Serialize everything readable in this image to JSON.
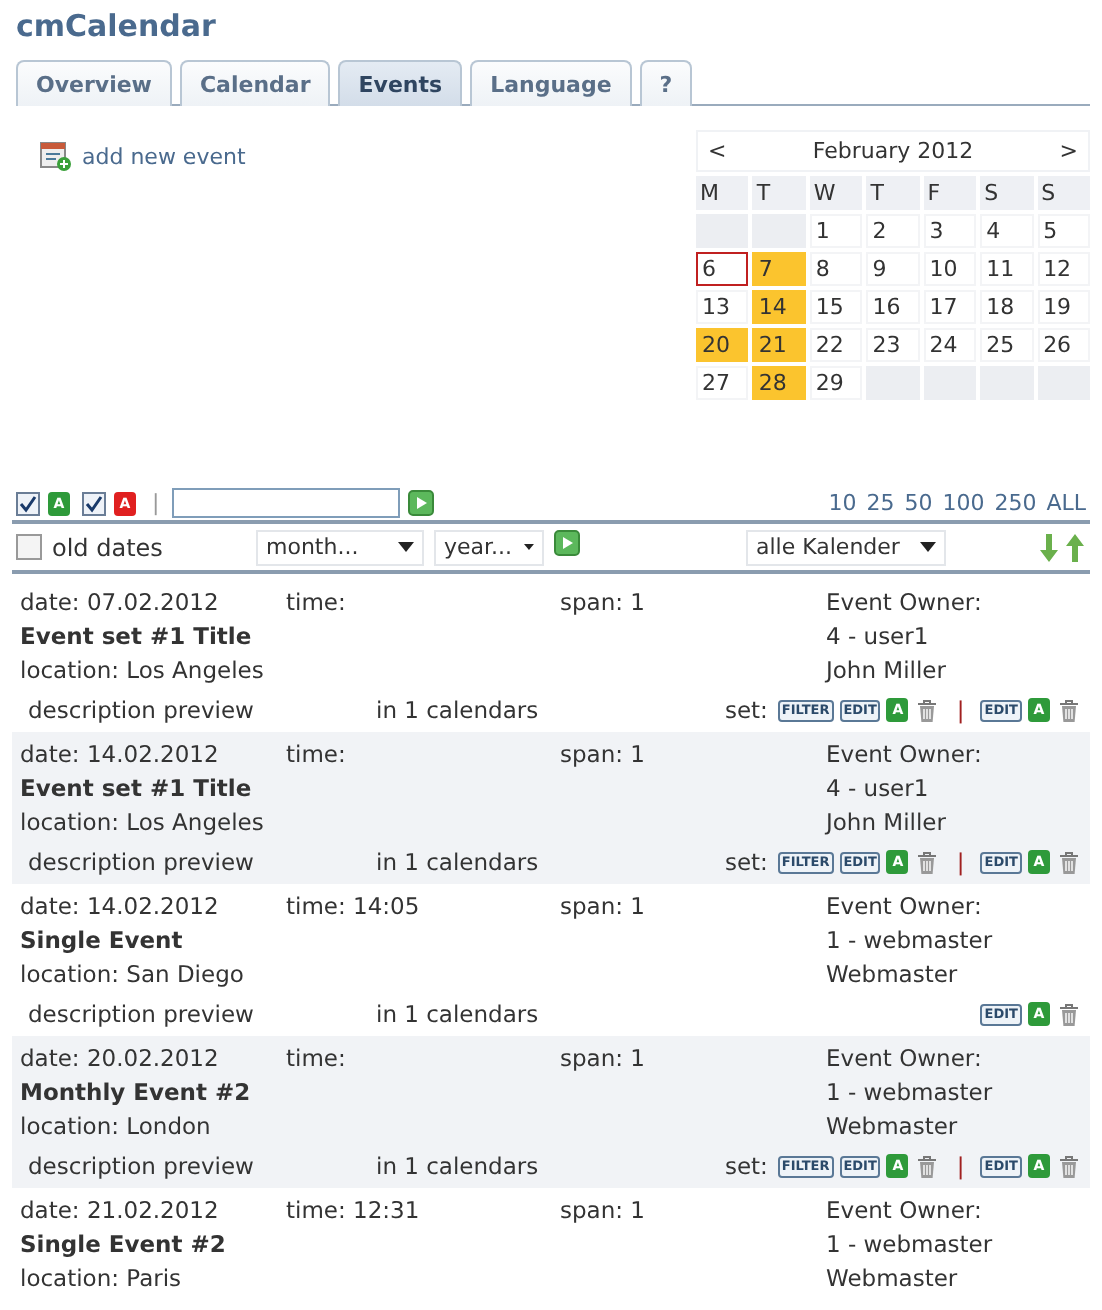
{
  "title": "cmCalendar",
  "tabs": [
    {
      "label": "Overview",
      "selected": false
    },
    {
      "label": "Calendar",
      "selected": false
    },
    {
      "label": "Events",
      "selected": true
    },
    {
      "label": "Language",
      "selected": false
    },
    {
      "label": "?",
      "selected": false
    }
  ],
  "add_event": "add new event",
  "calendar": {
    "prev": "<",
    "month": "February 2012",
    "next": ">",
    "weekdays": [
      "M",
      "T",
      "W",
      "T",
      "F",
      "S",
      "S"
    ],
    "days": [
      {
        "kind": "empty"
      },
      {
        "kind": "empty"
      },
      {
        "kind": "day",
        "text": "1",
        "today": false,
        "has_events": false
      },
      {
        "kind": "day",
        "text": "2",
        "today": false,
        "has_events": false
      },
      {
        "kind": "day",
        "text": "3",
        "today": false,
        "has_events": false
      },
      {
        "kind": "day",
        "text": "4",
        "today": false,
        "has_events": false
      },
      {
        "kind": "day",
        "text": "5",
        "today": false,
        "has_events": false
      },
      {
        "kind": "day",
        "text": "6",
        "today": true,
        "has_events": false
      },
      {
        "kind": "day",
        "text": "7",
        "today": false,
        "has_events": true
      },
      {
        "kind": "day",
        "text": "8",
        "today": false,
        "has_events": false
      },
      {
        "kind": "day",
        "text": "9",
        "today": false,
        "has_events": false
      },
      {
        "kind": "day",
        "text": "10",
        "today": false,
        "has_events": false
      },
      {
        "kind": "day",
        "text": "11",
        "today": false,
        "has_events": false
      },
      {
        "kind": "day",
        "text": "12",
        "today": false,
        "has_events": false
      },
      {
        "kind": "day",
        "text": "13",
        "today": false,
        "has_events": false
      },
      {
        "kind": "day",
        "text": "14",
        "today": false,
        "has_events": true
      },
      {
        "kind": "day",
        "text": "15",
        "today": false,
        "has_events": false
      },
      {
        "kind": "day",
        "text": "16",
        "today": false,
        "has_events": false
      },
      {
        "kind": "day",
        "text": "17",
        "today": false,
        "has_events": false
      },
      {
        "kind": "day",
        "text": "18",
        "today": false,
        "has_events": false
      },
      {
        "kind": "day",
        "text": "19",
        "today": false,
        "has_events": false
      },
      {
        "kind": "day",
        "text": "20",
        "today": false,
        "has_events": true
      },
      {
        "kind": "day",
        "text": "21",
        "today": false,
        "has_events": true
      },
      {
        "kind": "day",
        "text": "22",
        "today": false,
        "has_events": false
      },
      {
        "kind": "day",
        "text": "23",
        "today": false,
        "has_events": false
      },
      {
        "kind": "day",
        "text": "24",
        "today": false,
        "has_events": false
      },
      {
        "kind": "day",
        "text": "25",
        "today": false,
        "has_events": false
      },
      {
        "kind": "day",
        "text": "26",
        "today": false,
        "has_events": false
      },
      {
        "kind": "day",
        "text": "27",
        "today": false,
        "has_events": false
      },
      {
        "kind": "day",
        "text": "28",
        "today": false,
        "has_events": true
      },
      {
        "kind": "day",
        "text": "29",
        "today": false,
        "has_events": false
      },
      {
        "kind": "empty"
      },
      {
        "kind": "empty"
      },
      {
        "kind": "empty"
      },
      {
        "kind": "empty"
      }
    ]
  },
  "toolbar": {
    "status_filters": [
      {
        "checked": true,
        "badge": "A",
        "color": "#2e9a3a"
      },
      {
        "checked": true,
        "badge": "A",
        "color": "#e02020"
      }
    ],
    "separator": "|",
    "page_sizes": [
      "10",
      "25",
      "50",
      "100",
      "250",
      "ALL"
    ]
  },
  "filters": {
    "old_dates": {
      "label": "old dates",
      "checked": false
    },
    "month": "month...",
    "year": "year...",
    "calendars": "alle Kalender"
  },
  "events": [
    {
      "date": "date: 07.02.2012",
      "time": "time:",
      "span": "span: 1",
      "title": "Event set #1 Title",
      "location": "location: Los Angeles",
      "owner_label": "Event Owner:",
      "owner_id": "4 - user1",
      "owner_name": "John Miller",
      "description": "description preview",
      "calendars": "in 1 calendars",
      "set": {
        "label": "set:",
        "filter": "FILTER",
        "edit": "EDIT",
        "approve": "A"
      },
      "separator": "|",
      "actions": {
        "edit": "EDIT",
        "approve": "A"
      }
    },
    {
      "date": "date: 14.02.2012",
      "time": "time:",
      "span": "span: 1",
      "title": "Event set #1 Title",
      "location": "location: Los Angeles",
      "owner_label": "Event Owner:",
      "owner_id": "4 - user1",
      "owner_name": "John Miller",
      "description": "description preview",
      "calendars": "in 1 calendars",
      "set": {
        "label": "set:",
        "filter": "FILTER",
        "edit": "EDIT",
        "approve": "A"
      },
      "separator": "|",
      "actions": {
        "edit": "EDIT",
        "approve": "A"
      }
    },
    {
      "date": "date: 14.02.2012",
      "time": "time: 14:05",
      "span": "span: 1",
      "title": "Single Event",
      "location": "location: San Diego",
      "owner_label": "Event Owner:",
      "owner_id": "1 - webmaster",
      "owner_name": "Webmaster",
      "description": "description preview",
      "calendars": "in 1 calendars",
      "actions": {
        "edit": "EDIT",
        "approve": "A"
      }
    },
    {
      "date": "date: 20.02.2012",
      "time": "time:",
      "span": "span: 1",
      "title": "Monthly Event #2",
      "location": "location: London",
      "owner_label": "Event Owner:",
      "owner_id": "1 - webmaster",
      "owner_name": "Webmaster",
      "description": "description preview",
      "calendars": "in 1 calendars",
      "set": {
        "label": "set:",
        "filter": "FILTER",
        "edit": "EDIT",
        "approve": "A"
      },
      "separator": "|",
      "actions": {
        "edit": "EDIT",
        "approve": "A"
      }
    },
    {
      "date": "date: 21.02.2012",
      "time": "time: 12:31",
      "span": "span: 1",
      "title": "Single Event #2",
      "location": "location: Paris",
      "owner_label": "Event Owner:",
      "owner_id": "1 - webmaster",
      "owner_name": "Webmaster"
    }
  ]
}
